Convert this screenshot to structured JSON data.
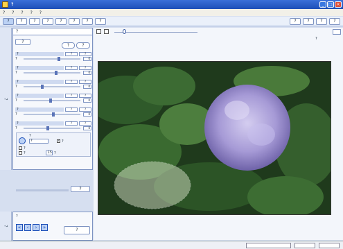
{
  "window": {
    "title": "?"
  },
  "menu": [
    "?",
    "?",
    "?",
    "?",
    "?"
  ],
  "toolbar": {
    "buttons": [
      "?",
      "?",
      "?",
      "?",
      "?",
      "?",
      "?",
      "?"
    ],
    "right_buttons": [
      "?",
      "?",
      "?",
      "?"
    ]
  },
  "left_tab": "?",
  "panel": {
    "title": "?",
    "button_left": "?",
    "button_right_1": "?",
    "button_right_2": "?",
    "groups": [
      {
        "label": "?",
        "pill1": "?",
        "pill2": "?",
        "row_label": "?",
        "value": "0"
      },
      {
        "label": "?",
        "pill1": "?",
        "pill2": "?",
        "row_label": "?",
        "value": "0"
      },
      {
        "label": "?",
        "pill1": "?",
        "pill2": "?",
        "row_label": "?",
        "value": "0"
      },
      {
        "label": "?",
        "pill1": "?",
        "pill2": "?",
        "row_label": "?",
        "value": "0"
      },
      {
        "label": "?",
        "pill1": "?",
        "pill2": "?",
        "row_label": "?",
        "value": "0"
      },
      {
        "label": "?",
        "pill1": "?",
        "pill2": "?",
        "row_label": "?",
        "value": "0"
      }
    ],
    "select": {
      "header": "?",
      "dropdown": "?",
      "check1": "?",
      "check2": "?",
      "check3": "?",
      "number": "15",
      "unit": "?"
    },
    "apply_button": "?"
  },
  "nav": {
    "header": "?",
    "button": "?",
    "side_tab": "?"
  },
  "view": {
    "zoom_label": "?"
  },
  "photo": {},
  "colors": {
    "accent": "#1d4fb8",
    "panel_bg": "#f6f8fc",
    "border": "#7d93c2"
  }
}
